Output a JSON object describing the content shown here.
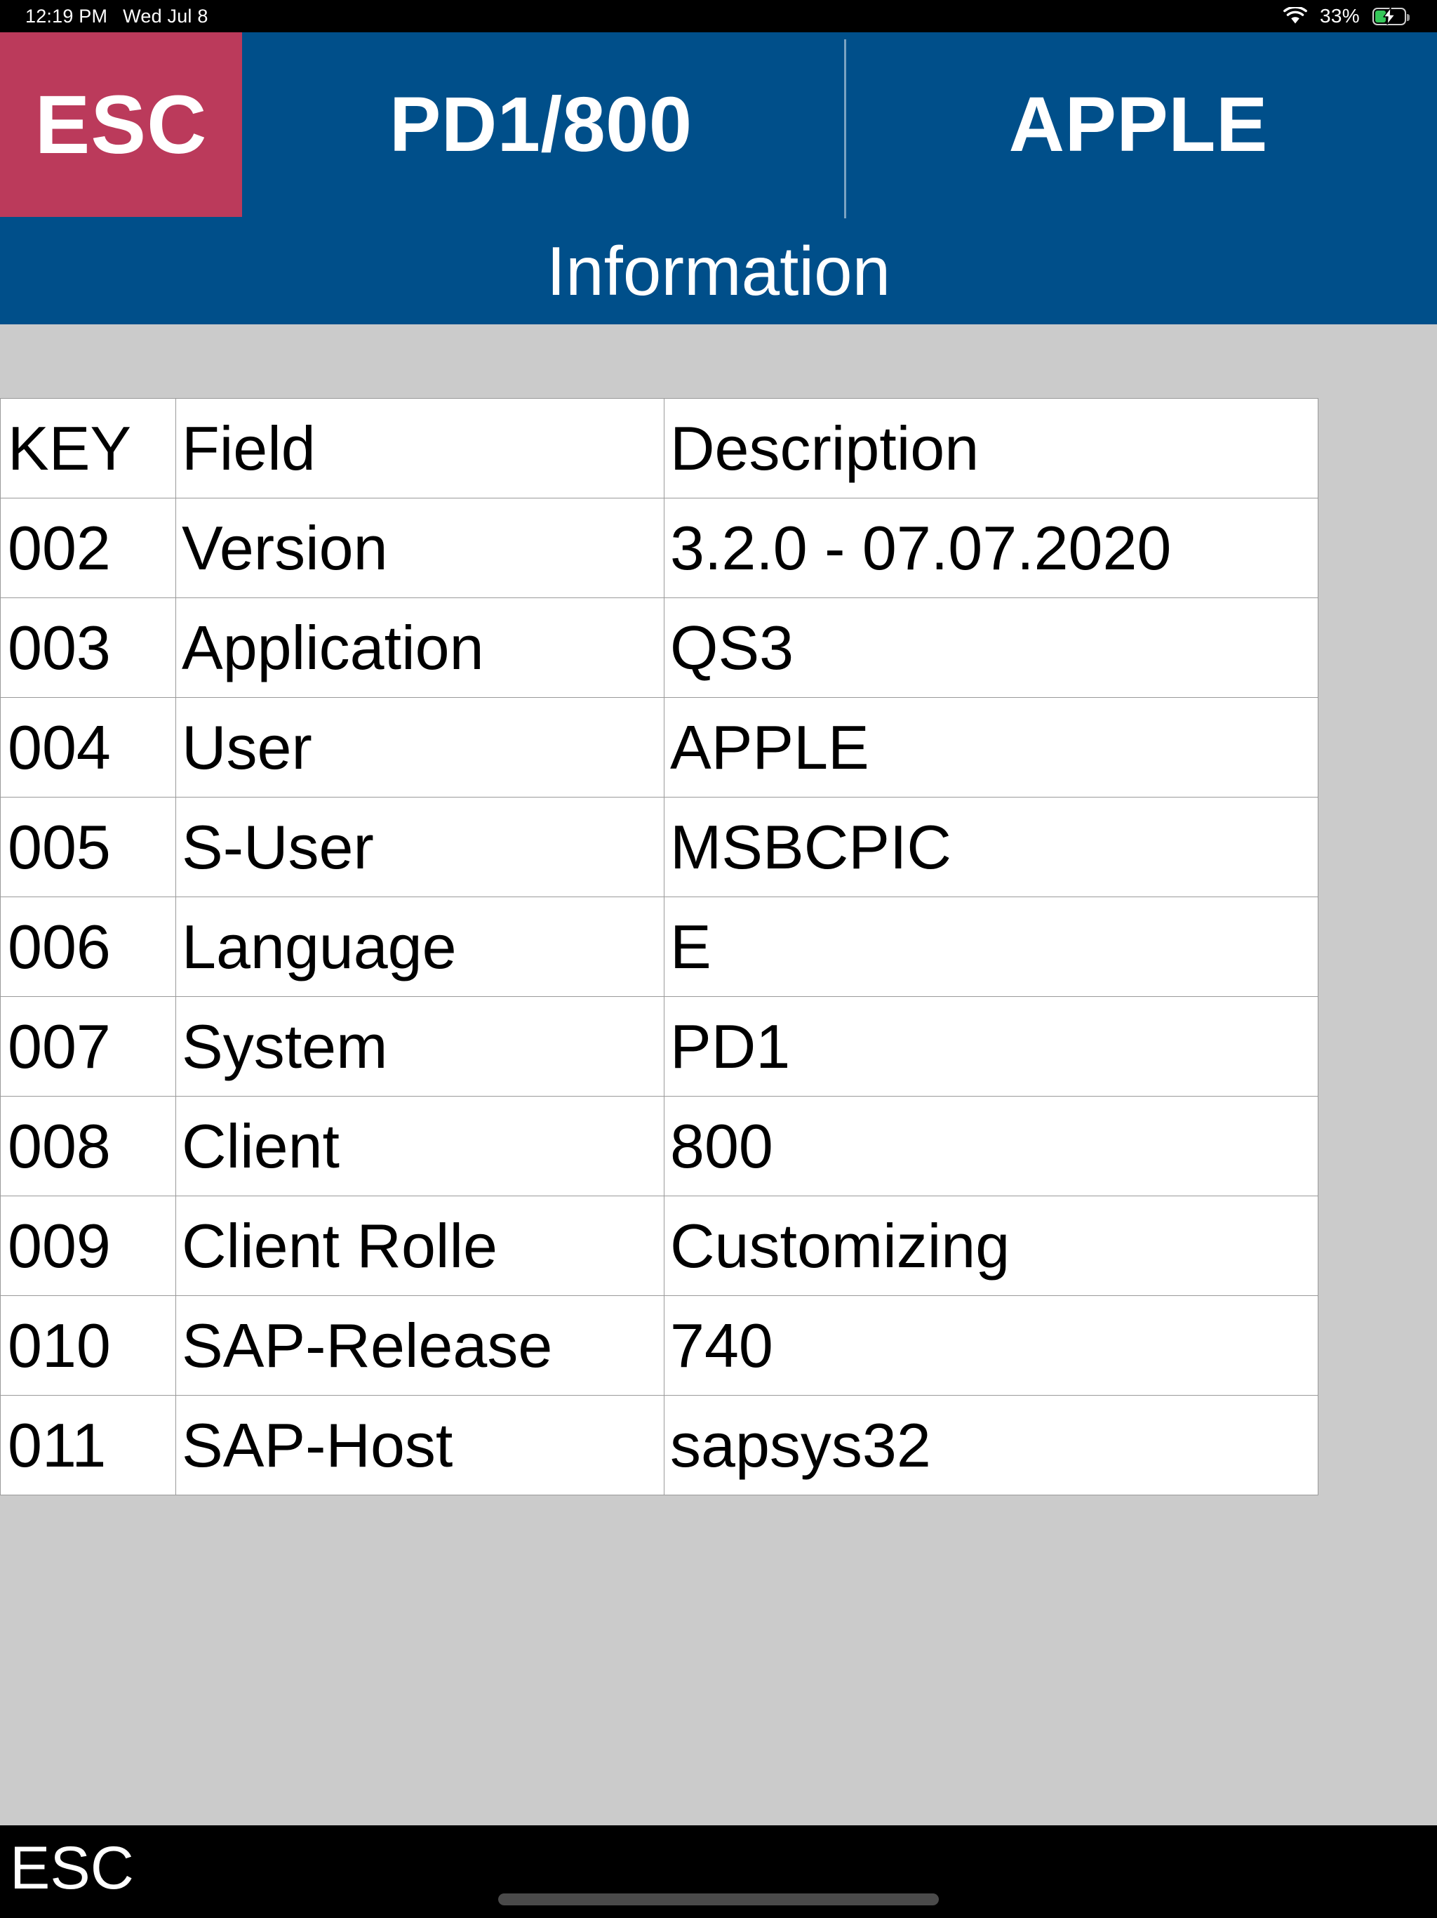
{
  "status_bar": {
    "time": "12:19 PM",
    "date": "Wed Jul 8",
    "wifi_icon": "wifi-icon",
    "battery_percent": "33%",
    "battery_icon": "battery-charging-icon"
  },
  "header": {
    "esc_label": "ESC",
    "system_client": "PD1/800",
    "user": "APPLE",
    "subtitle": "Information"
  },
  "table": {
    "columns": [
      "KEY",
      "Field",
      "Description"
    ],
    "rows": [
      {
        "key": "002",
        "field": "Version",
        "description": "3.2.0 - 07.07.2020"
      },
      {
        "key": "003",
        "field": "Application",
        "description": "QS3"
      },
      {
        "key": "004",
        "field": "User",
        "description": "APPLE"
      },
      {
        "key": "005",
        "field": "S-User",
        "description": "MSBCPIC"
      },
      {
        "key": "006",
        "field": "Language",
        "description": "E"
      },
      {
        "key": "007",
        "field": "System",
        "description": "PD1"
      },
      {
        "key": "008",
        "field": "Client",
        "description": "800"
      },
      {
        "key": "009",
        "field": "Client Rolle",
        "description": "Customizing"
      },
      {
        "key": "010",
        "field": "SAP-Release",
        "description": "740"
      },
      {
        "key": "011",
        "field": "SAP-Host",
        "description": "sapsys32"
      }
    ]
  },
  "bottom_bar": {
    "esc_label": "ESC"
  },
  "colors": {
    "header_blue": "#004f8a",
    "esc_red": "#bb3a5b",
    "body_gray": "#cbcbcb",
    "grid_line": "#9a9a9a",
    "battery_green": "#35c759"
  }
}
